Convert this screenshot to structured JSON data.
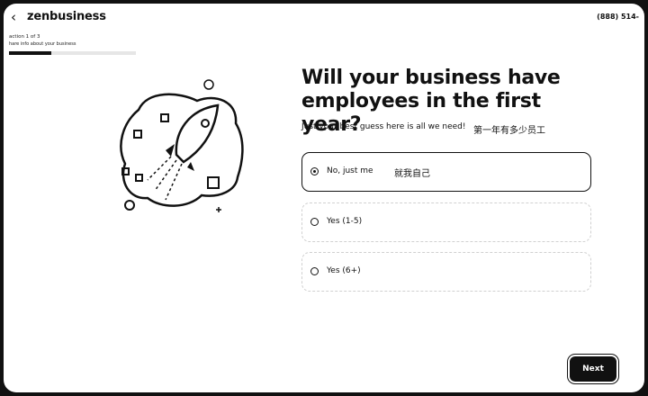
{
  "header": {
    "back_label": "‹",
    "logo": "zenbusiness",
    "phone": "(888) 514-"
  },
  "progress": {
    "section_label": "action 1 of 3",
    "step_label": "hare info about your business",
    "fraction": 0.33
  },
  "illustration": {
    "name": "rocket-illustration"
  },
  "main": {
    "question": "Will your business have employees in the first year?",
    "subtitle": "Just your best guess here is all we need!",
    "subtitle_note": "第一年有多少员工",
    "options": [
      {
        "label": "No, just me",
        "note": "就我自己",
        "selected": true
      },
      {
        "label": "Yes (1-5)",
        "note": "",
        "selected": false
      },
      {
        "label": "Yes (6+)",
        "note": "",
        "selected": false
      }
    ]
  },
  "footer": {
    "next_label": "Next"
  },
  "colors": {
    "border": "#111111",
    "background": "#ffffff",
    "button": "#111111"
  }
}
